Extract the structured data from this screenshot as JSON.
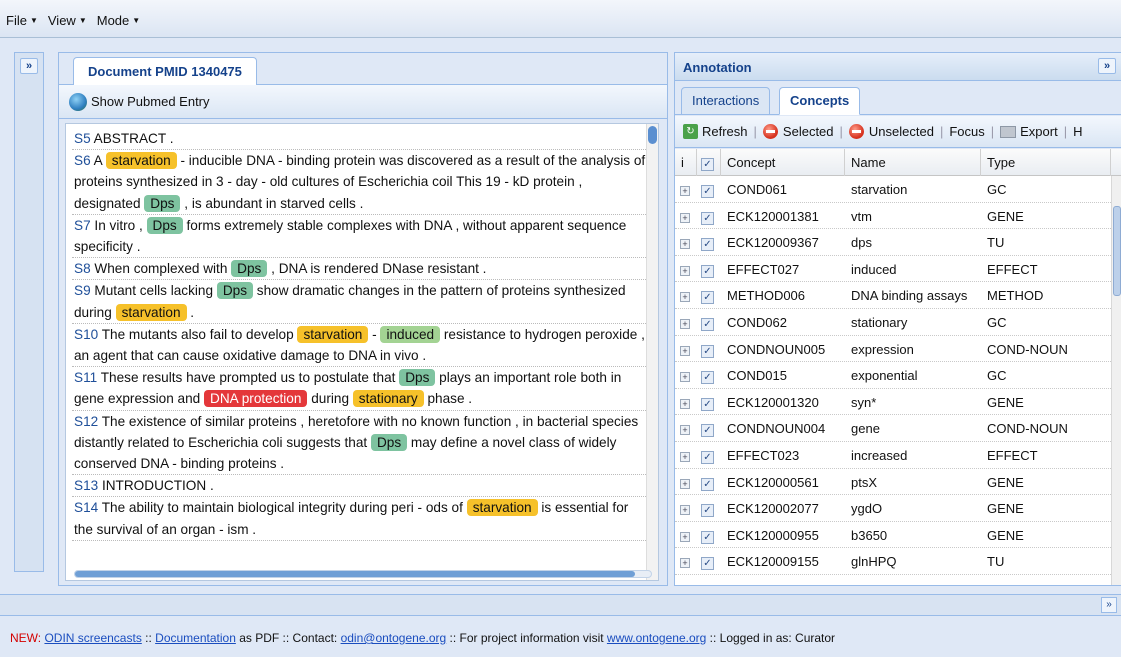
{
  "menu": {
    "file": "File",
    "view": "View",
    "mode": "Mode"
  },
  "document": {
    "tab_title": "Document PMID 1340475",
    "pubmed_button": "Show Pubmed Entry",
    "sentences": [
      [
        {
          "t": "S5",
          "k": "sid"
        },
        {
          "t": " ABSTRACT ."
        }
      ],
      [
        {
          "t": "S6",
          "k": "sid"
        },
        {
          "t": " A "
        },
        {
          "t": "starvation",
          "k": "gc"
        },
        {
          "t": " - inducible DNA - binding protein was discovered as a result of the analysis of proteins synthesized in 3 - day - old cultures of Escherichia coil This 19 - kD protein , designated "
        },
        {
          "t": "Dps",
          "k": "gene"
        },
        {
          "t": " , is abundant in starved cells ."
        }
      ],
      [
        {
          "t": "S7",
          "k": "sid"
        },
        {
          "t": " In vitro , "
        },
        {
          "t": "Dps",
          "k": "gene"
        },
        {
          "t": " forms extremely stable complexes with DNA , without apparent sequence specificity ."
        }
      ],
      [
        {
          "t": "S8",
          "k": "sid"
        },
        {
          "t": " When complexed with "
        },
        {
          "t": "Dps",
          "k": "gene"
        },
        {
          "t": " , DNA is rendered DNase resistant ."
        }
      ],
      [
        {
          "t": "S9",
          "k": "sid"
        },
        {
          "t": " Mutant cells lacking "
        },
        {
          "t": "Dps",
          "k": "gene"
        },
        {
          "t": " show dramatic changes in the pattern of proteins synthesized during "
        },
        {
          "t": "starvation",
          "k": "gc"
        },
        {
          "t": " ."
        }
      ],
      [
        {
          "t": "S10",
          "k": "sid"
        },
        {
          "t": " The mutants also fail to develop "
        },
        {
          "t": "starvation",
          "k": "gc"
        },
        {
          "t": " - "
        },
        {
          "t": "induced",
          "k": "effect"
        },
        {
          "t": " resistance to hydrogen peroxide , an agent that can cause oxidative damage to DNA in vivo ."
        }
      ],
      [
        {
          "t": "S11",
          "k": "sid"
        },
        {
          "t": " These results have prompted us to postulate that "
        },
        {
          "t": "Dps",
          "k": "gene"
        },
        {
          "t": " plays an important role both in gene expression and "
        },
        {
          "t": "DNA protection",
          "k": "dna"
        },
        {
          "t": " during "
        },
        {
          "t": "stationary",
          "k": "gc"
        },
        {
          "t": " phase ."
        }
      ],
      [
        {
          "t": "S12",
          "k": "sid"
        },
        {
          "t": " The existence of similar proteins , heretofore with no known function , in bacterial species distantly related to Escherichia coli suggests that "
        },
        {
          "t": "Dps",
          "k": "gene"
        },
        {
          "t": " may define a novel class of widely conserved DNA - binding proteins ."
        }
      ],
      [
        {
          "t": "S13",
          "k": "sid"
        },
        {
          "t": " INTRODUCTION ."
        }
      ],
      [
        {
          "t": "S14",
          "k": "sid"
        },
        {
          "t": " The ability to maintain biological integrity during peri - ods of "
        },
        {
          "t": "starvation",
          "k": "gc"
        },
        {
          "t": " is essential for the survival of an organ - ism ."
        }
      ]
    ]
  },
  "annotation": {
    "title": "Annotation",
    "tabs": [
      {
        "label": "Interactions"
      },
      {
        "label": "Concepts"
      }
    ],
    "toolbar": {
      "refresh": "Refresh",
      "selected": "Selected",
      "unselected": "Unselected",
      "focus": "Focus",
      "export": "Export",
      "more": "H"
    },
    "columns": {
      "info": "i",
      "concept": "Concept",
      "name": "Name",
      "type": "Type"
    },
    "rows": [
      {
        "concept": "COND061",
        "name": "starvation",
        "type": "GC"
      },
      {
        "concept": "ECK120001381",
        "name": "vtm",
        "type": "GENE"
      },
      {
        "concept": "ECK120009367",
        "name": "dps",
        "type": "TU"
      },
      {
        "concept": "EFFECT027",
        "name": "induced",
        "type": "EFFECT"
      },
      {
        "concept": "METHOD006",
        "name": "DNA binding assays",
        "type": "METHOD"
      },
      {
        "concept": "COND062",
        "name": "stationary",
        "type": "GC"
      },
      {
        "concept": "CONDNOUN005",
        "name": "expression",
        "type": "COND-NOUN"
      },
      {
        "concept": "COND015",
        "name": "exponential",
        "type": "GC"
      },
      {
        "concept": "ECK120001320",
        "name": "syn*",
        "type": "GENE"
      },
      {
        "concept": "CONDNOUN004",
        "name": "gene",
        "type": "COND-NOUN"
      },
      {
        "concept": "EFFECT023",
        "name": "increased",
        "type": "EFFECT"
      },
      {
        "concept": "ECK120000561",
        "name": "ptsX",
        "type": "GENE"
      },
      {
        "concept": "ECK120002077",
        "name": "ygdO",
        "type": "GENE"
      },
      {
        "concept": "ECK120000955",
        "name": "b3650",
        "type": "GENE"
      },
      {
        "concept": "ECK120009155",
        "name": "glnHPQ",
        "type": "TU"
      }
    ]
  },
  "footer": {
    "new_label": "NEW: ",
    "screencasts": "ODIN screencasts",
    "sep1": " :: ",
    "documentation": "Documentation",
    "pdf_text": " as PDF :: Contact: ",
    "email": "odin@ontogene.org",
    "info_text": "  ::  For project information visit ",
    "website": "www.ontogene.org",
    "login_text": " :: Logged in as: Curator"
  },
  "colors": {
    "gc": "#f6c12a",
    "gene": "#7ec3a0",
    "effect": "#a3d393",
    "dna": "#e4373a",
    "link": "#15428b"
  }
}
